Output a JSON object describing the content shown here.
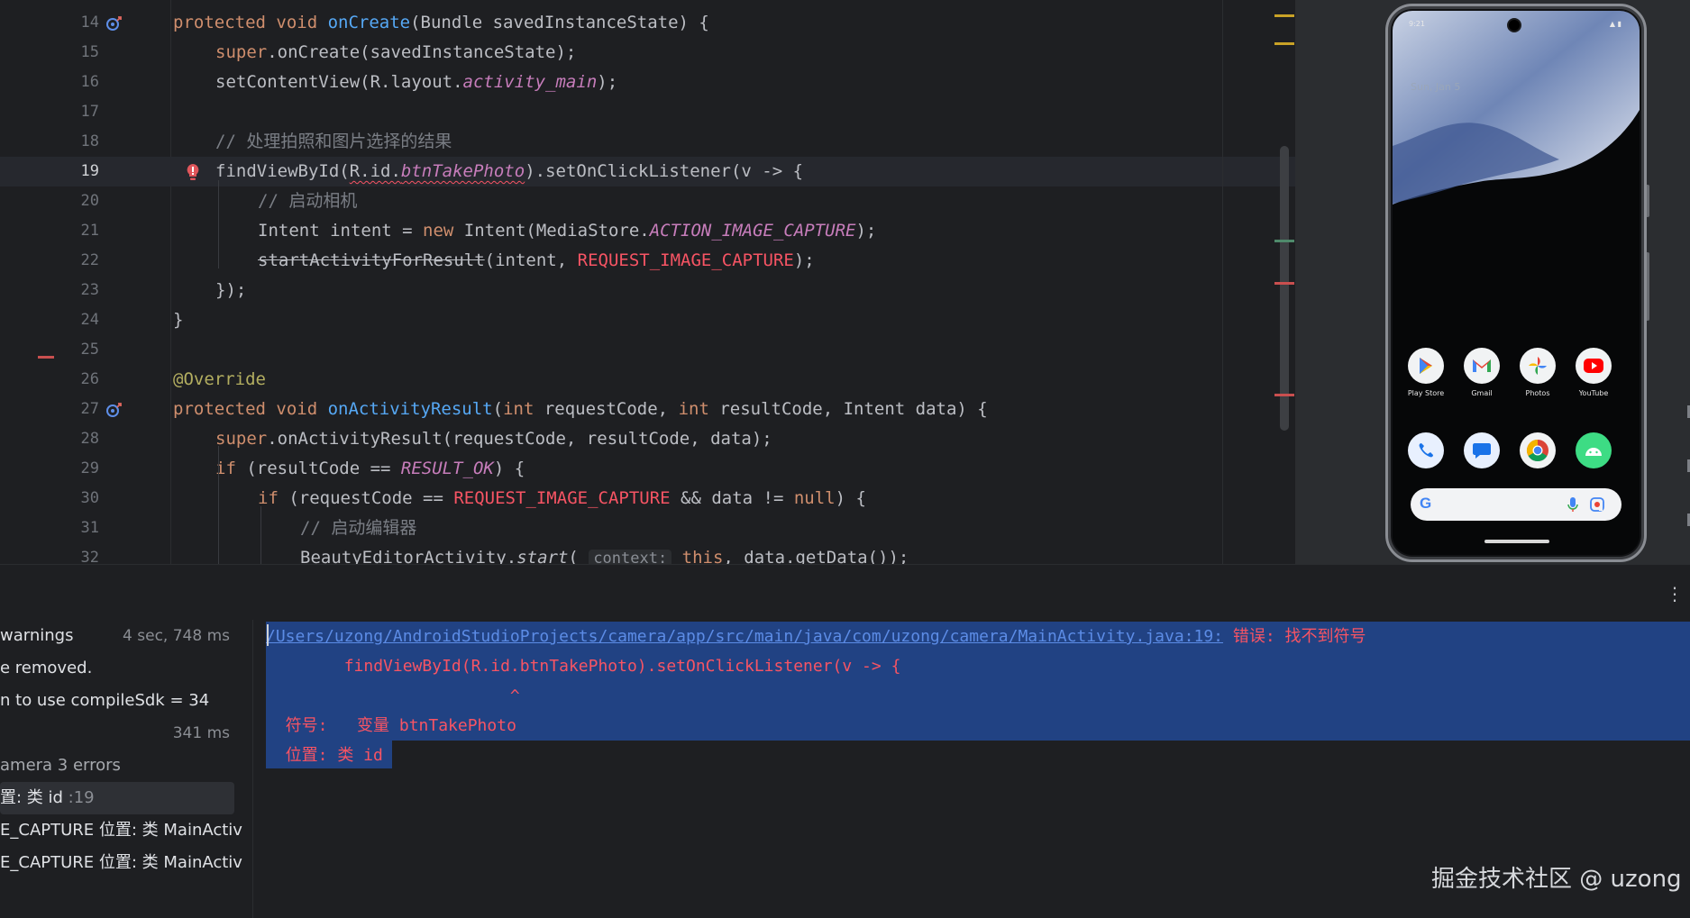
{
  "editor": {
    "lines": [
      {
        "n": "14",
        "html": "<span class=\"kw\">protected void </span><span class=\"fn\">onCreate</span>(Bundle savedInstanceState) {",
        "indent": 0
      },
      {
        "n": "15",
        "html": "<span class=\"kw\">super</span>.onCreate(savedInstanceState);",
        "indent": 1
      },
      {
        "n": "16",
        "html": "setContentView(R.layout.<span class=\"it\">activity_main</span>);",
        "indent": 1
      },
      {
        "n": "17",
        "html": "",
        "indent": 1
      },
      {
        "n": "18",
        "html": "<span class=\"cm\">// 处理拍照和图片选择的结果</span>",
        "indent": 1
      },
      {
        "n": "19",
        "html": "findViewById(<span class=\"err-ul\">R.id.<span class=\"cst\">btnTakePhoto</span></span>).setOnClickListener(v -&gt; {",
        "indent": 1
      },
      {
        "n": "20",
        "html": "<span class=\"cm\">// 启动相机</span>",
        "indent": 2
      },
      {
        "n": "21",
        "html": "Intent intent = <span class=\"kw\">new </span>Intent(MediaStore.<span class=\"cst\">ACTION_IMAGE_CAPTURE</span>);",
        "indent": 2
      },
      {
        "n": "22",
        "html": "<span class=\"strike\">startActivityForResult</span>(intent, <span class=\"red\">REQUEST_IMAGE_CAPTURE</span>);",
        "indent": 2
      },
      {
        "n": "23",
        "html": "});",
        "indent": 1
      },
      {
        "n": "24",
        "html": "}",
        "indent": 0
      },
      {
        "n": "25",
        "html": "",
        "indent": 0
      },
      {
        "n": "26",
        "html": "<span class=\"ann\">@Override</span>",
        "indent": 0
      },
      {
        "n": "27",
        "html": "<span class=\"kw\">protected void </span><span class=\"fn\">onActivityResult</span>(<span class=\"kw\">int </span>requestCode, <span class=\"kw\">int </span>resultCode, Intent data) {",
        "indent": 0
      },
      {
        "n": "28",
        "html": "<span class=\"kw\">super</span>.onActivityResult(requestCode, resultCode, data);",
        "indent": 1
      },
      {
        "n": "29",
        "html": "<span class=\"kw\">if </span>(resultCode == <span class=\"cst\">RESULT_OK</span>) {",
        "indent": 1
      },
      {
        "n": "30",
        "html": "<span class=\"kw\">if </span>(requestCode == <span class=\"red\">REQUEST_IMAGE_CAPTURE</span> &amp;&amp; data != <span class=\"kw\">null</span>) {",
        "indent": 2
      },
      {
        "n": "31",
        "html": "<span class=\"cm\">// 启动编辑器</span>",
        "indent": 3
      },
      {
        "n": "32",
        "html": "BeautyEditorActivity.<span class=\"ital\">start</span>( <span class=\"hint\">context:</span> <span class=\"kw\">this</span>, data.getData());",
        "indent": 3
      }
    ],
    "current_line": "19"
  },
  "phone": {
    "status_time": "9:21",
    "status_right": "▲ ▮",
    "date": "Sun, Jan 5",
    "apps_row1": [
      {
        "name": "play-store",
        "label": "Play Store"
      },
      {
        "name": "gmail",
        "label": "Gmail"
      },
      {
        "name": "photos",
        "label": "Photos"
      },
      {
        "name": "youtube",
        "label": "YouTube"
      }
    ],
    "apps_row2": [
      {
        "name": "phone"
      },
      {
        "name": "messages"
      },
      {
        "name": "chrome"
      },
      {
        "name": "android"
      }
    ],
    "search_g": "G"
  },
  "build": {
    "tree": [
      {
        "label": "warnings",
        "time": "4 sec, 748 ms"
      },
      {
        "label": "e removed.",
        "time": ""
      },
      {
        "label": "n to use compileSdk = 34",
        "time": ""
      },
      {
        "label": "",
        "time": "341 ms"
      },
      {
        "label": "amera 3 errors",
        "time": ""
      },
      {
        "label": "置: 类 id",
        "suffix": ":19",
        "time": ""
      },
      {
        "label": "E_CAPTURE 位置: 类 MainActiv",
        "time": ""
      },
      {
        "label": "E_CAPTURE 位置: 类 MainActiv",
        "time": ""
      }
    ],
    "console": {
      "path": "/Users/uzong/AndroidStudioProjects/camera/app/src/main/java/com/uzong/camera/MainActivity.java:19:",
      "error": " 错误: 找不到符号",
      "line2": "        findViewById(R.id.btnTakePhoto).setOnClickListener(v -> {",
      "line3": "                         ^",
      "line4": "  符号:   变量 btnTakePhoto",
      "line5": "  位置: 类 id"
    },
    "more_menu": "⋮"
  },
  "watermark": "掘金技术社区 @ uzong",
  "colors": {
    "background": "#1e1f22",
    "keyword": "#cf8e6d",
    "function": "#56a8f5",
    "constant": "#c77dbb",
    "error": "#f75464",
    "comment": "#7a7e85",
    "selection": "#214283"
  }
}
